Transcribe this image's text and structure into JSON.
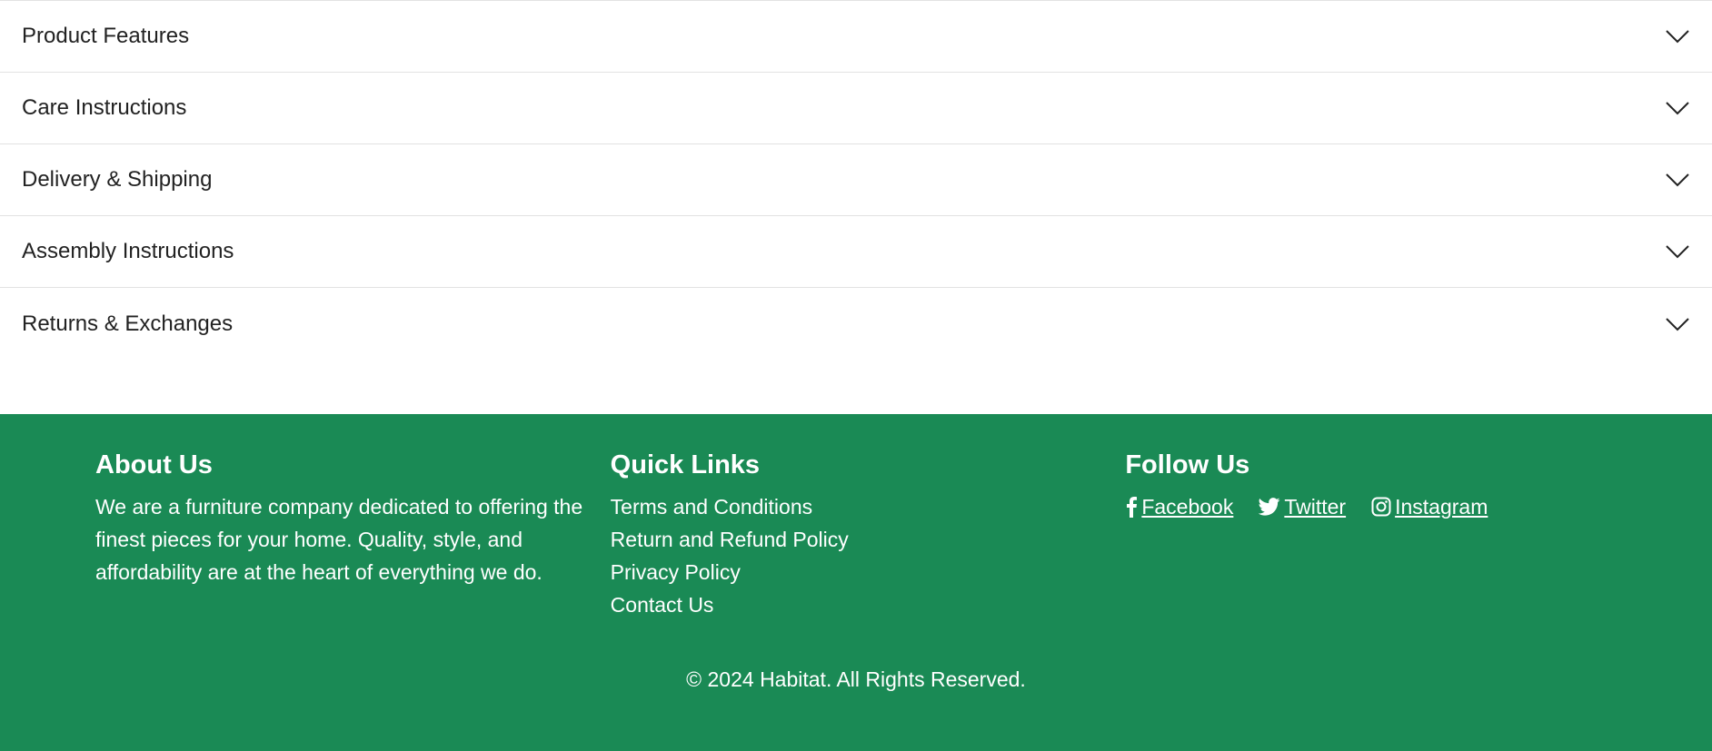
{
  "accordion": {
    "items": [
      {
        "label": "Product Features",
        "icon": "chevron-down-icon"
      },
      {
        "label": "Care Instructions",
        "icon": "chevron-down-icon"
      },
      {
        "label": "Delivery & Shipping",
        "icon": "chevron-down-icon"
      },
      {
        "label": "Assembly Instructions",
        "icon": "chevron-down-icon"
      },
      {
        "label": "Returns & Exchanges",
        "icon": "chevron-down-icon"
      }
    ]
  },
  "footer": {
    "background": "#1a8a55",
    "about": {
      "title": "About Us",
      "text": "We are a furniture company dedicated to offering the finest pieces for your home. Quality, style, and affordability are at the heart of everything we do."
    },
    "quick_links": {
      "title": "Quick Links",
      "links": [
        "Terms and Conditions",
        "Return and Refund Policy",
        "Privacy Policy",
        "Contact Us"
      ]
    },
    "follow": {
      "title": "Follow Us",
      "social": [
        {
          "label": " Facebook",
          "icon": "facebook-icon"
        },
        {
          "label": " Twitter",
          "icon": "twitter-icon"
        },
        {
          "label": " Instagram",
          "icon": "instagram-icon"
        }
      ]
    },
    "copyright": "© 2024 Habitat. All Rights Reserved."
  }
}
